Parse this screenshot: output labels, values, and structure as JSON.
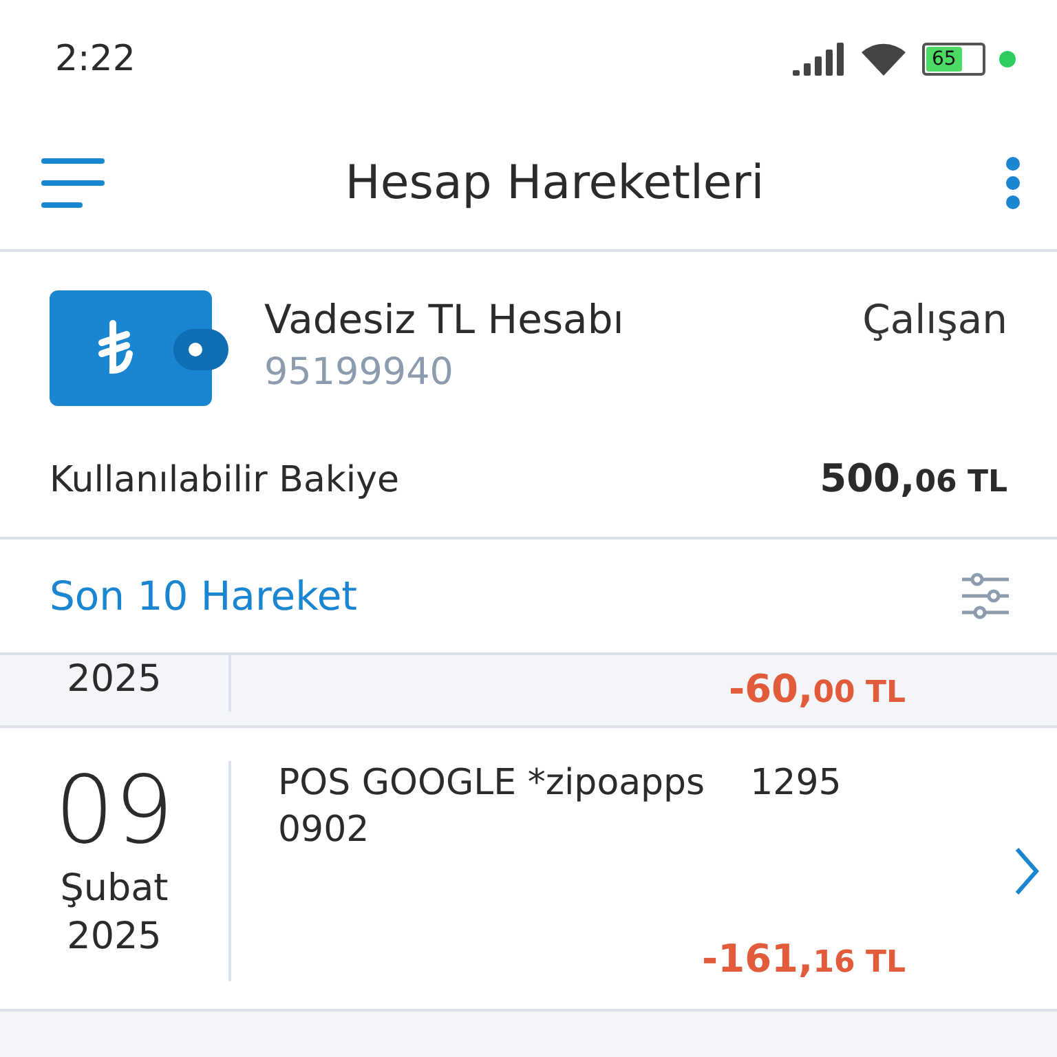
{
  "status_bar": {
    "time": "2:22",
    "battery_text": "65"
  },
  "header": {
    "title": "Hesap Hareketleri"
  },
  "account": {
    "name": "Vadesiz TL Hesabı",
    "number": "95199940",
    "type": "Çalışan",
    "balance_label": "Kullanılabilir Bakiye",
    "balance_main": "500,",
    "balance_fraction": "06 TL"
  },
  "section": {
    "title": "Son 10 Hareket"
  },
  "transactions": [
    {
      "shaded": true,
      "year": "2025",
      "amount_main": "-60,",
      "amount_fraction": "00 TL",
      "has_chevron": false
    },
    {
      "shaded": false,
      "day": "09",
      "month": "Şubat",
      "year": "2025",
      "description_lines": [
        "POS GOOGLE *zipoapps    1295",
        "0902"
      ],
      "amount_main": "-161,",
      "amount_fraction": "16 TL",
      "has_chevron": true
    }
  ]
}
